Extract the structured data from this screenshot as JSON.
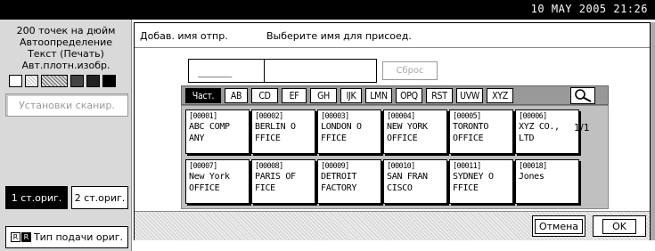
{
  "status": {
    "datetime": "10  MAY   2005 21:26"
  },
  "left_panel": {
    "resolution": "200 точек на дюйм",
    "auto_detect": "Автоопределение",
    "text_print": "Текст (Печать)",
    "auto_density": "Авт.плотн.изобр.",
    "scan_settings": "Установки сканир.",
    "orig_1_side": "1 ст.ориг.",
    "orig_2_side": "2 ст.ориг.",
    "feed_type": "Тип подачи ориг."
  },
  "dialog": {
    "header_left": "Добав. имя отпр.",
    "header_right": "Выберите имя для присоед.",
    "sender_value": "______",
    "clear_label": "Сброс",
    "page_indicator": "1/1",
    "cancel_label": "Отмена",
    "ok_label": "OK"
  },
  "tabs": [
    {
      "label": "Част."
    },
    {
      "label": "AB"
    },
    {
      "label": "CD"
    },
    {
      "label": "EF"
    },
    {
      "label": "GH"
    },
    {
      "label": "IJK"
    },
    {
      "label": "LMN"
    },
    {
      "label": "OPQ"
    },
    {
      "label": "RST"
    },
    {
      "label": "UVW"
    },
    {
      "label": "XYZ"
    }
  ],
  "entries": [
    {
      "code": "[00001]",
      "line1": "ABC COMP",
      "line2": "ANY"
    },
    {
      "code": "[00002]",
      "line1": "BERLIN O",
      "line2": "FFICE"
    },
    {
      "code": "[00003]",
      "line1": "LONDON O",
      "line2": "FFICE"
    },
    {
      "code": "[00004]",
      "line1": "NEW YORK",
      "line2": " OFFICE"
    },
    {
      "code": "[00005]",
      "line1": "TORONTO",
      "line2": "OFFICE"
    },
    {
      "code": "[00006]",
      "line1": "XYZ CO.,",
      "line2": "  LTD"
    },
    {
      "code": "[00007]",
      "line1": "New York",
      "line2": " OFFICE"
    },
    {
      "code": "[00008]",
      "line1": "PARIS OF",
      "line2": "FICE"
    },
    {
      "code": "[00009]",
      "line1": "DETROIT",
      "line2": "FACTORY"
    },
    {
      "code": "[00010]",
      "line1": "SAN FRAN",
      "line2": "CISCO"
    },
    {
      "code": "[00011]",
      "line1": "SYDNEY O",
      "line2": "FFICE"
    },
    {
      "code": "[00018]",
      "line1": "Jones",
      "line2": ""
    }
  ]
}
